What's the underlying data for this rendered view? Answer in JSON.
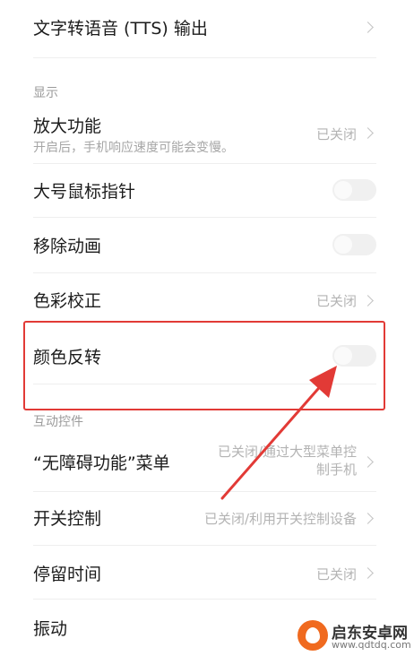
{
  "items": {
    "tts": {
      "title": "文字转语音 (TTS) 输出"
    },
    "section_display": "显示",
    "magnify": {
      "title": "放大功能",
      "subtitle": "开启后，手机响应速度可能会变慢。",
      "status": "已关闭"
    },
    "large_pointer": {
      "title": "大号鼠标指针"
    },
    "remove_animation": {
      "title": "移除动画"
    },
    "color_correction": {
      "title": "色彩校正",
      "status": "已关闭"
    },
    "color_inversion": {
      "title": "颜色反转"
    },
    "section_interaction": "互动控件",
    "accessibility_menu": {
      "title": "“无障碍功能”菜单",
      "status_line1": "已关闭/通过大型菜单控",
      "status_line2": "制手机"
    },
    "switch_control": {
      "title": "开关控制",
      "status": "已关闭/利用开关控制设备"
    },
    "dwell_time": {
      "title": "停留时间",
      "status": "已关闭"
    },
    "vibration": {
      "title": "振动"
    }
  },
  "colors": {
    "highlight": "#e23a36",
    "arrow": "#e23a36",
    "toggle_off": "#f0f0f0"
  },
  "watermark": {
    "title": "启东安卓网",
    "url": "www.qdtdq.com"
  }
}
